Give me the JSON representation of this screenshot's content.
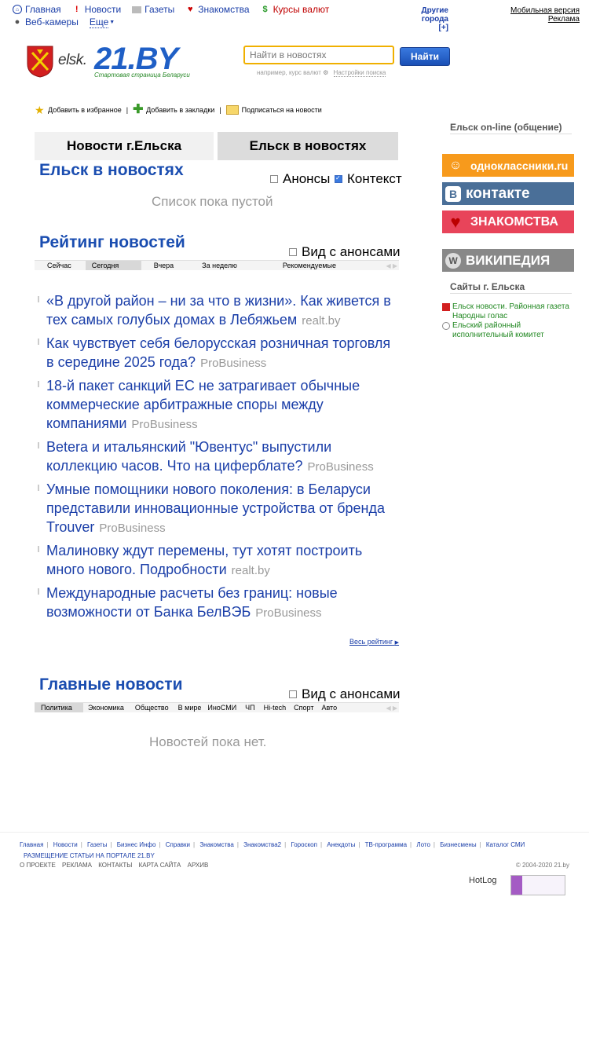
{
  "topnav": {
    "row1": [
      {
        "label": "Главная",
        "icon": "home-icon"
      },
      {
        "label": "Новости",
        "icon": "exclamation-icon"
      },
      {
        "label": "Газеты",
        "icon": "newspaper-icon"
      },
      {
        "label": "Знакомства",
        "icon": "heart-icon"
      },
      {
        "label": "Курсы валют",
        "icon": "dollar-icon"
      }
    ],
    "row2": [
      {
        "label": "Веб-камеры",
        "icon": "webcam-icon"
      },
      {
        "label": "Еще",
        "icon": "chevron-down-icon"
      }
    ]
  },
  "others": {
    "label": "Другие города",
    "plus": "[+]"
  },
  "mobile": {
    "version": "Мобильная версия",
    "ads": "Реклама"
  },
  "logo": {
    "city": "elsk.",
    "brand": "21.BY",
    "slogan": "Стартовая страница Беларуси"
  },
  "search": {
    "placeholder": "Найти в новостях",
    "button": "Найти",
    "hint": "например, курс валют",
    "settings": "Настройки поиска"
  },
  "actions": {
    "fav": "Добавить в избранное",
    "bookmarks": "Добавить в закладки",
    "subscribe": "Подписаться на новости"
  },
  "tabs": {
    "tab1": "Новости г.Ельска",
    "tab2": "Ельск в новостях"
  },
  "section1": {
    "title": "Ельск в новостях",
    "check1": "Анонсы",
    "check2": "Контекст",
    "empty": "Список пока пустой"
  },
  "rating": {
    "title": "Рейтинг новостей",
    "check": "Вид с анонсами",
    "periods": [
      "Сейчас",
      "Сегодня",
      "Вчера",
      "За неделю",
      "Рекомендуемые"
    ],
    "items": [
      {
        "text": "«В другой район – ни за что в жизни». Как живется в тех самых голубых домах в Лебяжьем",
        "src": "realt.by"
      },
      {
        "text": "Как чувствует себя белорусская розничная торговля в середине 2025 года?",
        "src": "ProBusiness"
      },
      {
        "text": "18-й пакет санкций ЕС не затрагивает обычные коммерческие арбитражные споры между компаниями",
        "src": "ProBusiness"
      },
      {
        "text": "Betera и итальянский \"Ювентус\" выпустили коллекцию часов. Что на циферблате?",
        "src": "ProBusiness"
      },
      {
        "text": "Умные помощники нового поколения: в Беларуси представили инновационные устройства от бренда Trouver",
        "src": "ProBusiness"
      },
      {
        "text": "Малиновку ждут перемены, тут хотят построить много нового. Подробности",
        "src": "realt.by"
      },
      {
        "text": "Международные расчеты без границ: новые возможности от Банка БелВЭБ",
        "src": "ProBusiness"
      }
    ],
    "all": "Весь рейтинг"
  },
  "main": {
    "title": "Главные новости",
    "check": "Вид с анонсами",
    "cats": [
      "Политика",
      "Экономика",
      "Общество",
      "В мире",
      "ИноСМИ",
      "ЧП",
      "Hi-tech",
      "Спорт",
      "Авто"
    ],
    "empty": "Новостей пока нет."
  },
  "right": {
    "online": "Ельск on-line (общение)",
    "banners": {
      "ok": "одноклассники.ru",
      "vk": "контакте",
      "zn": "ЗНАКОМСТВА",
      "wiki": "ВИКИПЕДИЯ"
    },
    "sites_title": "Сайты г. Ельска",
    "sites": [
      "Ельск новости. Районная газета Народны голас",
      "Ельский районный исполнительный комитет"
    ]
  },
  "footer": {
    "links": [
      "Главная",
      "Новости",
      "Газеты",
      "Бизнес Инфо",
      "Справки",
      "Знакомства",
      "Знакомства2",
      "Гороскоп",
      "Анекдоты",
      "ТВ-программа",
      "Лото",
      "Бизнесмены",
      "Каталог СМИ"
    ],
    "place": "РАЗМЕЩЕНИЕ СТАТЬИ НА ПОРТАЛЕ 21.BY",
    "sub": [
      "О ПРОЕКТЕ",
      "РЕКЛАМА",
      "КОНТАКТЫ",
      "КАРТА САЙТА",
      "АРХИВ"
    ],
    "copy": "© 2004-2020 21.by",
    "hotlog": "HotLog"
  }
}
